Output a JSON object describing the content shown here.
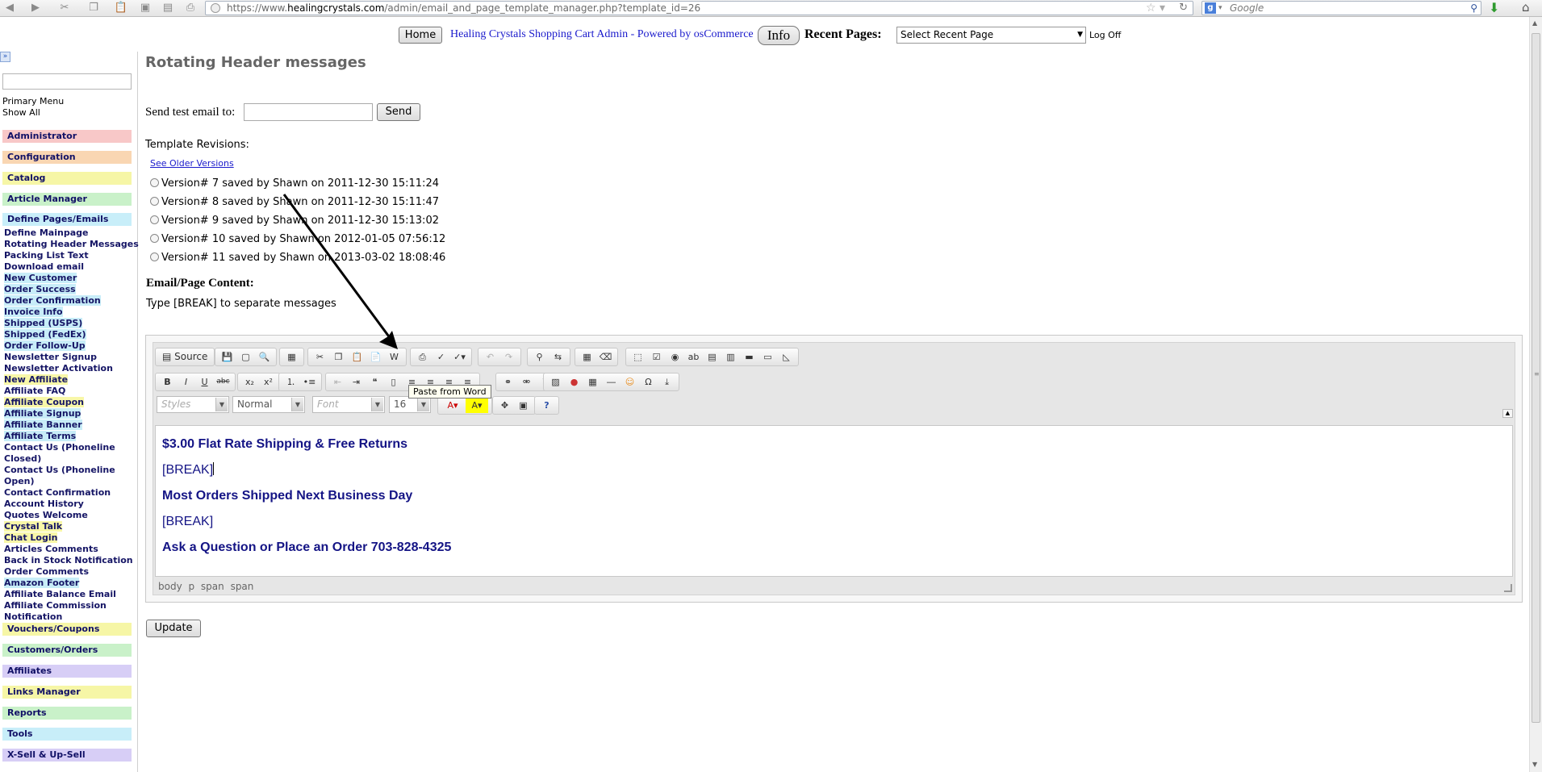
{
  "browser": {
    "url_prefix": "https://www.",
    "url_domain": "healingcrystals.com",
    "url_path": "/admin/email_and_page_template_manager.php?template_id=26",
    "search_placeholder": "Google",
    "search_engine_letter": "g"
  },
  "header": {
    "home_label": "Home",
    "admin_link": "Healing Crystals Shopping Cart Admin - Powered by osCommerce",
    "info_label": "Info",
    "recent_pages_label": "Recent Pages:",
    "recent_select_value": "Select Recent Page",
    "logoff_label": "Log Off"
  },
  "sidebar": {
    "primary_menu_label": "Primary Menu",
    "show_all_label": "Show All",
    "categories_top": [
      {
        "label": "Administrator",
        "color": "#f8c8c8"
      },
      {
        "label": "Configuration",
        "color": "#f9d6b2"
      },
      {
        "label": "Catalog",
        "color": "#f6f6a6"
      },
      {
        "label": "Article Manager",
        "color": "#c9f1c9"
      },
      {
        "label": "Define Pages/Emails",
        "color": "#c8eef9"
      }
    ],
    "subitems": [
      "Define Mainpage",
      "Rotating Header Messages",
      "Packing List Text",
      "Download email",
      "New Customer",
      "Order Success",
      "Order Confirmation",
      "Invoice Info",
      "Shipped (USPS)",
      "Shipped (FedEx)",
      "Order Follow-Up",
      "Newsletter Signup",
      "Newsletter Activation",
      "New Affiliate",
      "Affiliate FAQ",
      "Affiliate Coupon",
      "Affiliate Signup",
      "Affiliate Banner",
      "Affiliate Terms",
      "Contact Us (Phoneline",
      "Closed)",
      "Contact Us (Phoneline",
      "Open)",
      "Contact Confirmation",
      "Account History",
      "Quotes Welcome",
      "Crystal Talk",
      "Chat Login",
      "Articles Comments",
      "Back in Stock Notification",
      "Order Comments",
      "Amazon Footer",
      "Affiliate Balance Email",
      "Affiliate Commission",
      "Notification"
    ],
    "categories_bottom": [
      {
        "label": "Vouchers/Coupons",
        "color": "#f6f6a6"
      },
      {
        "label": "Customers/Orders",
        "color": "#c9f1c9"
      },
      {
        "label": "Affiliates",
        "color": "#d7cef6"
      },
      {
        "label": "Links Manager",
        "color": "#f6f6a6"
      },
      {
        "label": "Reports",
        "color": "#c9f1c9"
      },
      {
        "label": "Tools",
        "color": "#c8eef9"
      },
      {
        "label": "X-Sell & Up-Sell",
        "color": "#d7cef6"
      }
    ]
  },
  "main": {
    "page_title": "Rotating Header messages",
    "send_test_label": "Send test email to:",
    "send_button": "Send",
    "revisions_label": "Template Revisions:",
    "older_versions_link": "See Older Versions",
    "revisions": [
      "Version# 7 saved by Shawn on 2011-12-30 15:11:24",
      "Version# 8 saved by Shawn on 2011-12-30 15:11:47",
      "Version# 9 saved by Shawn on 2011-12-30 15:13:02",
      "Version# 10 saved by Shawn on 2012-01-05 07:56:12",
      "Version# 11 saved by Shawn on 2013-03-02 18:08:46"
    ],
    "content_label": "Email/Page Content:",
    "break_hint": "Type [BREAK] to separate messages",
    "update_button": "Update"
  },
  "editor": {
    "source_label": "Source",
    "tooltip": "Paste from Word",
    "styles_placeholder": "Styles",
    "format_value": "Normal",
    "font_placeholder": "Font",
    "size_value": "16",
    "content_lines": [
      "$3.00 Flat Rate Shipping & Free Returns",
      "[BREAK]",
      "Most Orders Shipped Next Business Day",
      "[BREAK]",
      "Ask a Question or Place an Order 703-828-4325"
    ],
    "path": "body p span span"
  }
}
